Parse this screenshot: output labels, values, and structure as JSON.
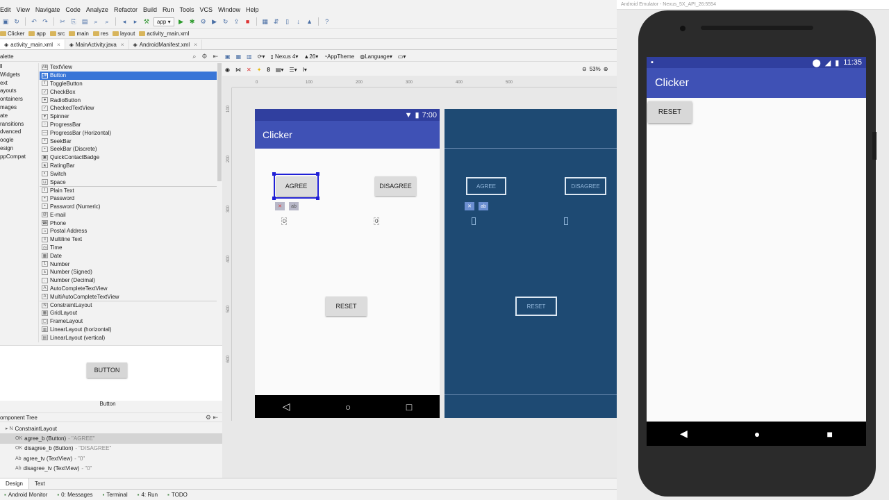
{
  "menu": [
    "Edit",
    "View",
    "Navigate",
    "Code",
    "Analyze",
    "Refactor",
    "Build",
    "Run",
    "Tools",
    "VCS",
    "Window",
    "Help"
  ],
  "toolbar": {
    "run_config": "app"
  },
  "breadcrumb": [
    "Clicker",
    "app",
    "src",
    "main",
    "res",
    "layout",
    "activity_main.xml"
  ],
  "editor_tabs": [
    {
      "label": "activity_main.xml",
      "active": true
    },
    {
      "label": "MainActivity.java",
      "active": false
    },
    {
      "label": "AndroidManifest.xml",
      "active": false
    }
  ],
  "palette": {
    "title": "alette",
    "categories": [
      "ll",
      "Widgets",
      "ext",
      "ayouts",
      "ontainers",
      "mages",
      "ate",
      "ransitions",
      "dvanced",
      "oogle",
      "esign",
      "ppCompat"
    ],
    "items": [
      {
        "label": "TextView",
        "icon": "Ab"
      },
      {
        "label": "Button",
        "icon": "OK",
        "selected": true
      },
      {
        "label": "ToggleButton",
        "icon": "T"
      },
      {
        "label": "CheckBox",
        "icon": "✓"
      },
      {
        "label": "RadioButton",
        "icon": "●"
      },
      {
        "label": "CheckedTextView",
        "icon": "✓"
      },
      {
        "label": "Spinner",
        "icon": "▾"
      },
      {
        "label": "ProgressBar",
        "icon": "◌"
      },
      {
        "label": "ProgressBar (Horizontal)",
        "icon": "—"
      },
      {
        "label": "SeekBar",
        "icon": "•"
      },
      {
        "label": "SeekBar (Discrete)",
        "icon": "•"
      },
      {
        "label": "QuickContactBadge",
        "icon": "▣"
      },
      {
        "label": "RatingBar",
        "icon": "★"
      },
      {
        "label": "Switch",
        "icon": "◐"
      },
      {
        "label": "Space",
        "icon": "⊔"
      },
      {
        "label": "Plain Text",
        "icon": "I",
        "group": true
      },
      {
        "label": "Password",
        "icon": "•"
      },
      {
        "label": "Password (Numeric)",
        "icon": "•"
      },
      {
        "label": "E-mail",
        "icon": "@"
      },
      {
        "label": "Phone",
        "icon": "☎"
      },
      {
        "label": "Postal Address",
        "icon": "⌂"
      },
      {
        "label": "Multiline Text",
        "icon": "≡"
      },
      {
        "label": "Time",
        "icon": "◷"
      },
      {
        "label": "Date",
        "icon": "▦"
      },
      {
        "label": "Number",
        "icon": "1"
      },
      {
        "label": "Number (Signed)",
        "icon": "±"
      },
      {
        "label": "Number (Decimal)",
        "icon": "."
      },
      {
        "label": "AutoCompleteTextView",
        "icon": "A"
      },
      {
        "label": "MultiAutoCompleteTextView",
        "icon": "A"
      },
      {
        "label": "ConstraintLayout",
        "icon": "N",
        "group": true
      },
      {
        "label": "GridLayout",
        "icon": "▦"
      },
      {
        "label": "FrameLayout",
        "icon": "▢"
      },
      {
        "label": "LinearLayout (horizontal)",
        "icon": "▥"
      },
      {
        "label": "LinearLayout (vertical)",
        "icon": "▤"
      }
    ]
  },
  "preview": {
    "button": "BUTTON",
    "label": "Button"
  },
  "component_tree": {
    "title": "omponent Tree",
    "rows": [
      {
        "name": "ConstraintLayout",
        "detail": "",
        "indent": 8
      },
      {
        "name": "agree_b (Button)",
        "detail": "- \"AGREE\"",
        "indent": 22,
        "selected": true
      },
      {
        "name": "disagree_b (Button)",
        "detail": "- \"DISAGREE\"",
        "indent": 22
      },
      {
        "name": "agree_tv (TextView)",
        "detail": "- \"0\"",
        "indent": 22
      },
      {
        "name": "disagree_tv (TextView)",
        "detail": "- \"0\"",
        "indent": 22
      }
    ]
  },
  "bottom_tabs": [
    "Design",
    "Text"
  ],
  "statusbar": [
    "Android Monitor",
    "0: Messages",
    "Terminal",
    "4: Run",
    "TODO"
  ],
  "design_toolbar": {
    "device": "Nexus 4",
    "api": "26",
    "theme": "AppTheme",
    "language": "Language",
    "default_margin": "8",
    "zoom": "53%"
  },
  "rulers": {
    "h": [
      "0",
      "100",
      "200",
      "300",
      "400",
      "500"
    ],
    "v": [
      "100",
      "200",
      "300",
      "400",
      "500",
      "600"
    ]
  },
  "design_phone": {
    "time": "7:00",
    "app_title": "Clicker",
    "agree": "AGREE",
    "disagree": "DISAGREE",
    "reset": "RESET",
    "agree_count": "0",
    "disagree_count": "0"
  },
  "blueprint": {
    "agree": "AGREE",
    "disagree": "DISAGREE",
    "reset": "RESET"
  },
  "emulator": {
    "window_title": "Android Emulator - Nexus_5X_API_26:5554",
    "time": "11:35",
    "app_title": "Clicker",
    "reset": "RESET"
  },
  "colors": {
    "primary": "#3f51b5",
    "primary_dark": "#303f9f",
    "selection": "#3875d7",
    "blueprint": "#1e4a73"
  }
}
